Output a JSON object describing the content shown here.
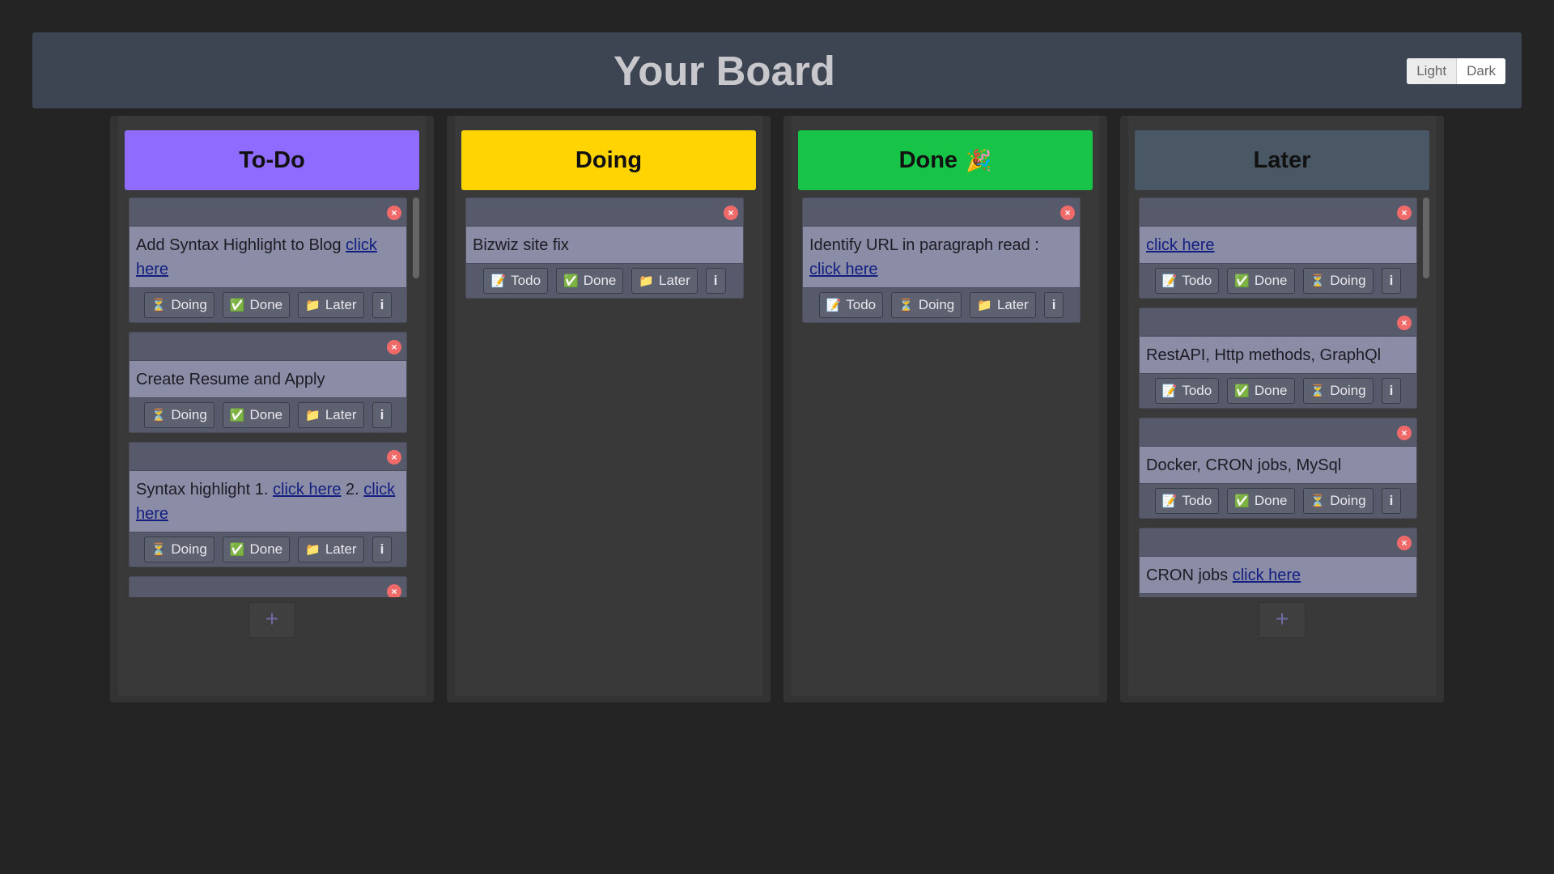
{
  "header": {
    "title": "Your Board"
  },
  "theme": {
    "light_label": "Light",
    "dark_label": "Dark"
  },
  "icons": {
    "close": "×",
    "info": "i",
    "add": "+",
    "Todo": "📝",
    "Doing": "⏳",
    "Done": "✅",
    "Later": "📁",
    "party": "🎉"
  },
  "columns": [
    {
      "key": "todo",
      "title": "To-Do",
      "color": "#8f6bff",
      "emoji": "",
      "scrollbar": true,
      "add_button": true,
      "cards": [
        {
          "text": "Add Syntax Highlight to Blog ",
          "links": [
            "click here"
          ],
          "actions": [
            "Doing",
            "Done",
            "Later"
          ]
        },
        {
          "text": "Create Resume and Apply",
          "links": [],
          "actions": [
            "Doing",
            "Done",
            "Later"
          ]
        },
        {
          "text": "Syntax highlight 1. ",
          "links": [
            "click here"
          ],
          "middle": " 2. ",
          "links2": [
            "click here"
          ],
          "actions": [
            "Doing",
            "Done",
            "Later"
          ]
        },
        {
          "text": "",
          "links": [],
          "actions": []
        }
      ]
    },
    {
      "key": "doing",
      "title": "Doing",
      "color": "#ffd400",
      "emoji": "",
      "scrollbar": false,
      "add_button": false,
      "cards": [
        {
          "text": "Bizwiz site fix",
          "links": [],
          "actions": [
            "Todo",
            "Done",
            "Later"
          ]
        }
      ]
    },
    {
      "key": "done",
      "title": "Done",
      "color": "#17c448",
      "emoji": "🎉",
      "scrollbar": false,
      "add_button": false,
      "cards": [
        {
          "text": "Identify URL in paragraph read : ",
          "links": [
            "click here"
          ],
          "actions": [
            "Todo",
            "Doing",
            "Later"
          ]
        }
      ]
    },
    {
      "key": "later",
      "title": "Later",
      "color": "#4a5866",
      "emoji": "",
      "scrollbar": true,
      "add_button": true,
      "cards": [
        {
          "text": "",
          "links": [
            "click here"
          ],
          "actions": [
            "Todo",
            "Done",
            "Doing"
          ]
        },
        {
          "text": "RestAPI, Http methods, GraphQl",
          "links": [],
          "actions": [
            "Todo",
            "Done",
            "Doing"
          ]
        },
        {
          "text": "Docker, CRON jobs, MySql",
          "links": [],
          "actions": [
            "Todo",
            "Done",
            "Doing"
          ]
        },
        {
          "text": "CRON jobs ",
          "links": [
            "click here"
          ],
          "actions": [
            "Todo",
            "Done",
            "Doing"
          ]
        }
      ]
    }
  ]
}
